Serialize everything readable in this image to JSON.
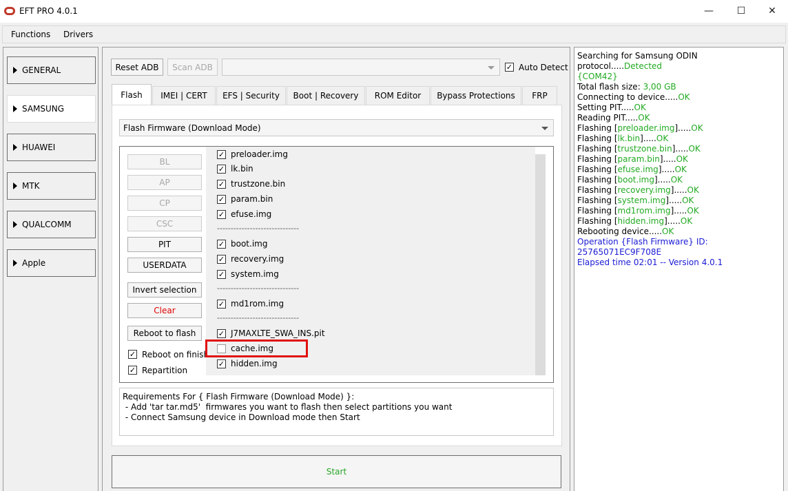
{
  "window": {
    "title": "EFT PRO 4.0.1",
    "minimize": "—",
    "maximize": "☐",
    "close": "✕"
  },
  "menu": [
    "Functions",
    "Drivers"
  ],
  "brands": [
    "GENERAL",
    "SAMSUNG",
    "HUAWEI",
    "MTK",
    "QUALCOMM",
    "Apple"
  ],
  "selected_brand": "SAMSUNG",
  "top_bar": {
    "reset_adb": "Reset ADB",
    "scan_adb": "Scan ADB",
    "port_value": "",
    "auto_detect": "Auto Detect",
    "auto_detect_checked": true
  },
  "tabs": [
    "Flash",
    "IMEI | CERT",
    "EFS | Security",
    "Boot | Recovery",
    "ROM Editor",
    "Bypass Protections",
    "FRP"
  ],
  "active_tab": "Flash",
  "mode_select": "Flash Firmware (Download Mode)",
  "file_buttons": [
    "BL",
    "AP",
    "CP",
    "CSC",
    "PIT",
    "USERDATA"
  ],
  "actions": {
    "invert_selection": "Invert selection",
    "clear": "Clear",
    "reboot_to_flash": "Reboot to flash",
    "reboot_on_finish": "Reboot on finish",
    "repartition": "Repartition"
  },
  "partitions": [
    {
      "label": "preloader.img",
      "checked": true
    },
    {
      "label": "lk.bin",
      "checked": true
    },
    {
      "label": "trustzone.bin",
      "checked": true
    },
    {
      "label": "param.bin",
      "checked": true
    },
    {
      "label": "efuse.img",
      "checked": true
    },
    {
      "separator": "------------------------------"
    },
    {
      "label": "boot.img",
      "checked": true
    },
    {
      "label": "recovery.img",
      "checked": true
    },
    {
      "label": "system.img",
      "checked": true
    },
    {
      "separator": "------------------------------"
    },
    {
      "label": "md1rom.img",
      "checked": true
    },
    {
      "separator": "------------------------------"
    },
    {
      "label": "J7MAXLTE_SWA_INS.pit",
      "checked": true
    },
    {
      "label": "cache.img",
      "checked": false
    },
    {
      "label": "hidden.img",
      "checked": true
    }
  ],
  "requirements": [
    "Requirements For { Flash Firmware (Download Mode) }:",
    " - Add 'tar tar.md5'  firmwares you want to flash then select partitions you want",
    " - Connect Samsung device in Download mode then Start"
  ],
  "start": "Start",
  "log": [
    [
      {
        "t": "Searching for Samsung ODIN protocol....."
      },
      {
        "t": "Detected",
        "c": "ok"
      }
    ],
    [
      {
        "t": "{COM42}",
        "c": "ok"
      }
    ],
    [
      {
        "t": "Total flash size: "
      },
      {
        "t": "3,00 GB",
        "c": "ok"
      }
    ],
    [
      {
        "t": "Connecting to device....."
      },
      {
        "t": "OK",
        "c": "ok"
      }
    ],
    [
      {
        "t": "Setting PIT....."
      },
      {
        "t": "OK",
        "c": "ok"
      }
    ],
    [
      {
        "t": "Reading PIT....."
      },
      {
        "t": "OK",
        "c": "ok"
      }
    ],
    [
      {
        "t": "Flashing ["
      },
      {
        "t": "preloader.img",
        "c": "ok"
      },
      {
        "t": "]....."
      },
      {
        "t": "OK",
        "c": "ok"
      }
    ],
    [
      {
        "t": "Flashing ["
      },
      {
        "t": "lk.bin",
        "c": "ok"
      },
      {
        "t": "]....."
      },
      {
        "t": "OK",
        "c": "ok"
      }
    ],
    [
      {
        "t": "Flashing ["
      },
      {
        "t": "trustzone.bin",
        "c": "ok"
      },
      {
        "t": "]....."
      },
      {
        "t": "OK",
        "c": "ok"
      }
    ],
    [
      {
        "t": "Flashing ["
      },
      {
        "t": "param.bin",
        "c": "ok"
      },
      {
        "t": "]....."
      },
      {
        "t": "OK",
        "c": "ok"
      }
    ],
    [
      {
        "t": "Flashing ["
      },
      {
        "t": "efuse.img",
        "c": "ok"
      },
      {
        "t": "]....."
      },
      {
        "t": "OK",
        "c": "ok"
      }
    ],
    [
      {
        "t": "Flashing ["
      },
      {
        "t": "boot.img",
        "c": "ok"
      },
      {
        "t": "]....."
      },
      {
        "t": "OK",
        "c": "ok"
      }
    ],
    [
      {
        "t": "Flashing ["
      },
      {
        "t": "recovery.img",
        "c": "ok"
      },
      {
        "t": "]....."
      },
      {
        "t": "OK",
        "c": "ok"
      }
    ],
    [
      {
        "t": "Flashing ["
      },
      {
        "t": "system.img",
        "c": "ok"
      },
      {
        "t": "]....."
      },
      {
        "t": "OK",
        "c": "ok"
      }
    ],
    [
      {
        "t": "Flashing ["
      },
      {
        "t": "md1rom.img",
        "c": "ok"
      },
      {
        "t": "]....."
      },
      {
        "t": "OK",
        "c": "ok"
      }
    ],
    [
      {
        "t": "Flashing ["
      },
      {
        "t": "hidden.img",
        "c": "ok"
      },
      {
        "t": "]....."
      },
      {
        "t": "OK",
        "c": "ok"
      }
    ],
    [
      {
        "t": "Rebooting device....."
      },
      {
        "t": "OK",
        "c": "ok"
      }
    ],
    [
      {
        "t": "Operation {Flash Firmware} ID: 25765071EC9F708E",
        "c": "blue"
      }
    ],
    [
      {
        "t": "Elapsed time 02:01 -- Version 4.0.1",
        "c": "blue"
      }
    ]
  ],
  "colors": {
    "ok": "#22aa22",
    "info": "#1a1ad4",
    "clear": "#e00000",
    "highlight": "#e01010"
  }
}
